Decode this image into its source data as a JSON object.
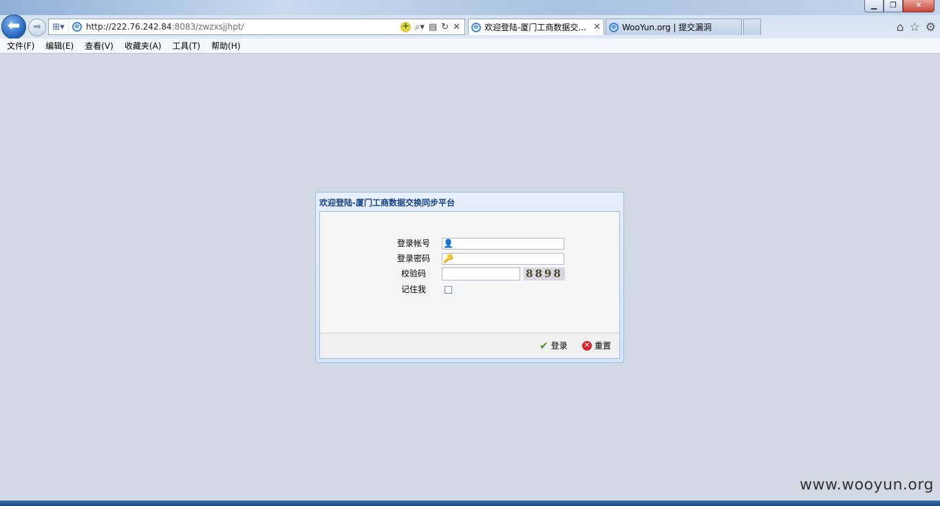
{
  "browser": {
    "url_host": "http://222.76.242.84",
    "url_rest": ":8083/zwzxsjjhpt/",
    "tabs": [
      {
        "label": "欢迎登陆-厦门工商数据交...",
        "active": true
      },
      {
        "label": "WooYun.org | 提交漏洞",
        "active": false
      }
    ],
    "window_controls": {
      "minimize": "▁",
      "restore": "❐",
      "close": "✕"
    }
  },
  "menu": {
    "items": [
      "文件(F)",
      "编辑(E)",
      "查看(V)",
      "收藏夹(A)",
      "工具(T)",
      "帮助(H)"
    ]
  },
  "login": {
    "title": "欢迎登陆-厦门工商数据交换同步平台",
    "account_label": "登录帐号",
    "password_label": "登录密码",
    "captcha_label": "校验码",
    "remember_label": "记住我",
    "captcha_text": "8898",
    "login_button": "登录",
    "reset_button": "重置",
    "account_value": "",
    "password_value": "",
    "captcha_value": "",
    "remember_checked": false
  },
  "watermark": "www.wooyun.org",
  "colors": {
    "page_bg": "#d3d9e3",
    "panel_border": "#99bbe8",
    "panel_title": "#15428b"
  }
}
